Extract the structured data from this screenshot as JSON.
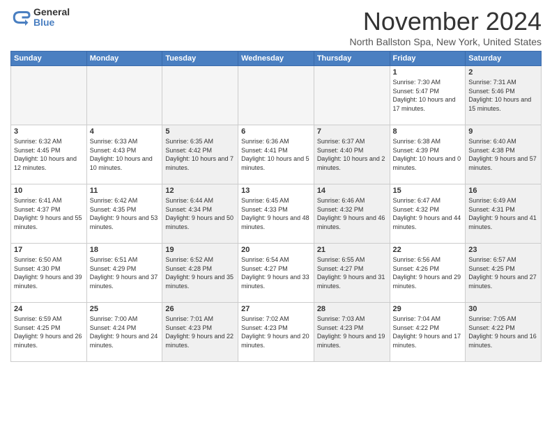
{
  "logo": {
    "general": "General",
    "blue": "Blue"
  },
  "title": "November 2024",
  "location": "North Ballston Spa, New York, United States",
  "days_header": [
    "Sunday",
    "Monday",
    "Tuesday",
    "Wednesday",
    "Thursday",
    "Friday",
    "Saturday"
  ],
  "weeks": [
    [
      {
        "day": "",
        "empty": true
      },
      {
        "day": "",
        "empty": true
      },
      {
        "day": "",
        "empty": true
      },
      {
        "day": "",
        "empty": true
      },
      {
        "day": "",
        "empty": true
      },
      {
        "day": "1",
        "info": "Sunrise: 7:30 AM\nSunset: 5:47 PM\nDaylight: 10 hours and 17 minutes."
      },
      {
        "day": "2",
        "info": "Sunrise: 7:31 AM\nSunset: 5:46 PM\nDaylight: 10 hours and 15 minutes."
      }
    ],
    [
      {
        "day": "3",
        "info": "Sunrise: 6:32 AM\nSunset: 4:45 PM\nDaylight: 10 hours and 12 minutes."
      },
      {
        "day": "4",
        "info": "Sunrise: 6:33 AM\nSunset: 4:43 PM\nDaylight: 10 hours and 10 minutes."
      },
      {
        "day": "5",
        "info": "Sunrise: 6:35 AM\nSunset: 4:42 PM\nDaylight: 10 hours and 7 minutes."
      },
      {
        "day": "6",
        "info": "Sunrise: 6:36 AM\nSunset: 4:41 PM\nDaylight: 10 hours and 5 minutes."
      },
      {
        "day": "7",
        "info": "Sunrise: 6:37 AM\nSunset: 4:40 PM\nDaylight: 10 hours and 2 minutes."
      },
      {
        "day": "8",
        "info": "Sunrise: 6:38 AM\nSunset: 4:39 PM\nDaylight: 10 hours and 0 minutes."
      },
      {
        "day": "9",
        "info": "Sunrise: 6:40 AM\nSunset: 4:38 PM\nDaylight: 9 hours and 57 minutes."
      }
    ],
    [
      {
        "day": "10",
        "info": "Sunrise: 6:41 AM\nSunset: 4:37 PM\nDaylight: 9 hours and 55 minutes."
      },
      {
        "day": "11",
        "info": "Sunrise: 6:42 AM\nSunset: 4:35 PM\nDaylight: 9 hours and 53 minutes."
      },
      {
        "day": "12",
        "info": "Sunrise: 6:44 AM\nSunset: 4:34 PM\nDaylight: 9 hours and 50 minutes."
      },
      {
        "day": "13",
        "info": "Sunrise: 6:45 AM\nSunset: 4:33 PM\nDaylight: 9 hours and 48 minutes."
      },
      {
        "day": "14",
        "info": "Sunrise: 6:46 AM\nSunset: 4:32 PM\nDaylight: 9 hours and 46 minutes."
      },
      {
        "day": "15",
        "info": "Sunrise: 6:47 AM\nSunset: 4:32 PM\nDaylight: 9 hours and 44 minutes."
      },
      {
        "day": "16",
        "info": "Sunrise: 6:49 AM\nSunset: 4:31 PM\nDaylight: 9 hours and 41 minutes."
      }
    ],
    [
      {
        "day": "17",
        "info": "Sunrise: 6:50 AM\nSunset: 4:30 PM\nDaylight: 9 hours and 39 minutes."
      },
      {
        "day": "18",
        "info": "Sunrise: 6:51 AM\nSunset: 4:29 PM\nDaylight: 9 hours and 37 minutes."
      },
      {
        "day": "19",
        "info": "Sunrise: 6:52 AM\nSunset: 4:28 PM\nDaylight: 9 hours and 35 minutes."
      },
      {
        "day": "20",
        "info": "Sunrise: 6:54 AM\nSunset: 4:27 PM\nDaylight: 9 hours and 33 minutes."
      },
      {
        "day": "21",
        "info": "Sunrise: 6:55 AM\nSunset: 4:27 PM\nDaylight: 9 hours and 31 minutes."
      },
      {
        "day": "22",
        "info": "Sunrise: 6:56 AM\nSunset: 4:26 PM\nDaylight: 9 hours and 29 minutes."
      },
      {
        "day": "23",
        "info": "Sunrise: 6:57 AM\nSunset: 4:25 PM\nDaylight: 9 hours and 27 minutes."
      }
    ],
    [
      {
        "day": "24",
        "info": "Sunrise: 6:59 AM\nSunset: 4:25 PM\nDaylight: 9 hours and 26 minutes."
      },
      {
        "day": "25",
        "info": "Sunrise: 7:00 AM\nSunset: 4:24 PM\nDaylight: 9 hours and 24 minutes."
      },
      {
        "day": "26",
        "info": "Sunrise: 7:01 AM\nSunset: 4:23 PM\nDaylight: 9 hours and 22 minutes."
      },
      {
        "day": "27",
        "info": "Sunrise: 7:02 AM\nSunset: 4:23 PM\nDaylight: 9 hours and 20 minutes."
      },
      {
        "day": "28",
        "info": "Sunrise: 7:03 AM\nSunset: 4:23 PM\nDaylight: 9 hours and 19 minutes."
      },
      {
        "day": "29",
        "info": "Sunrise: 7:04 AM\nSunset: 4:22 PM\nDaylight: 9 hours and 17 minutes."
      },
      {
        "day": "30",
        "info": "Sunrise: 7:05 AM\nSunset: 4:22 PM\nDaylight: 9 hours and 16 minutes."
      }
    ]
  ]
}
